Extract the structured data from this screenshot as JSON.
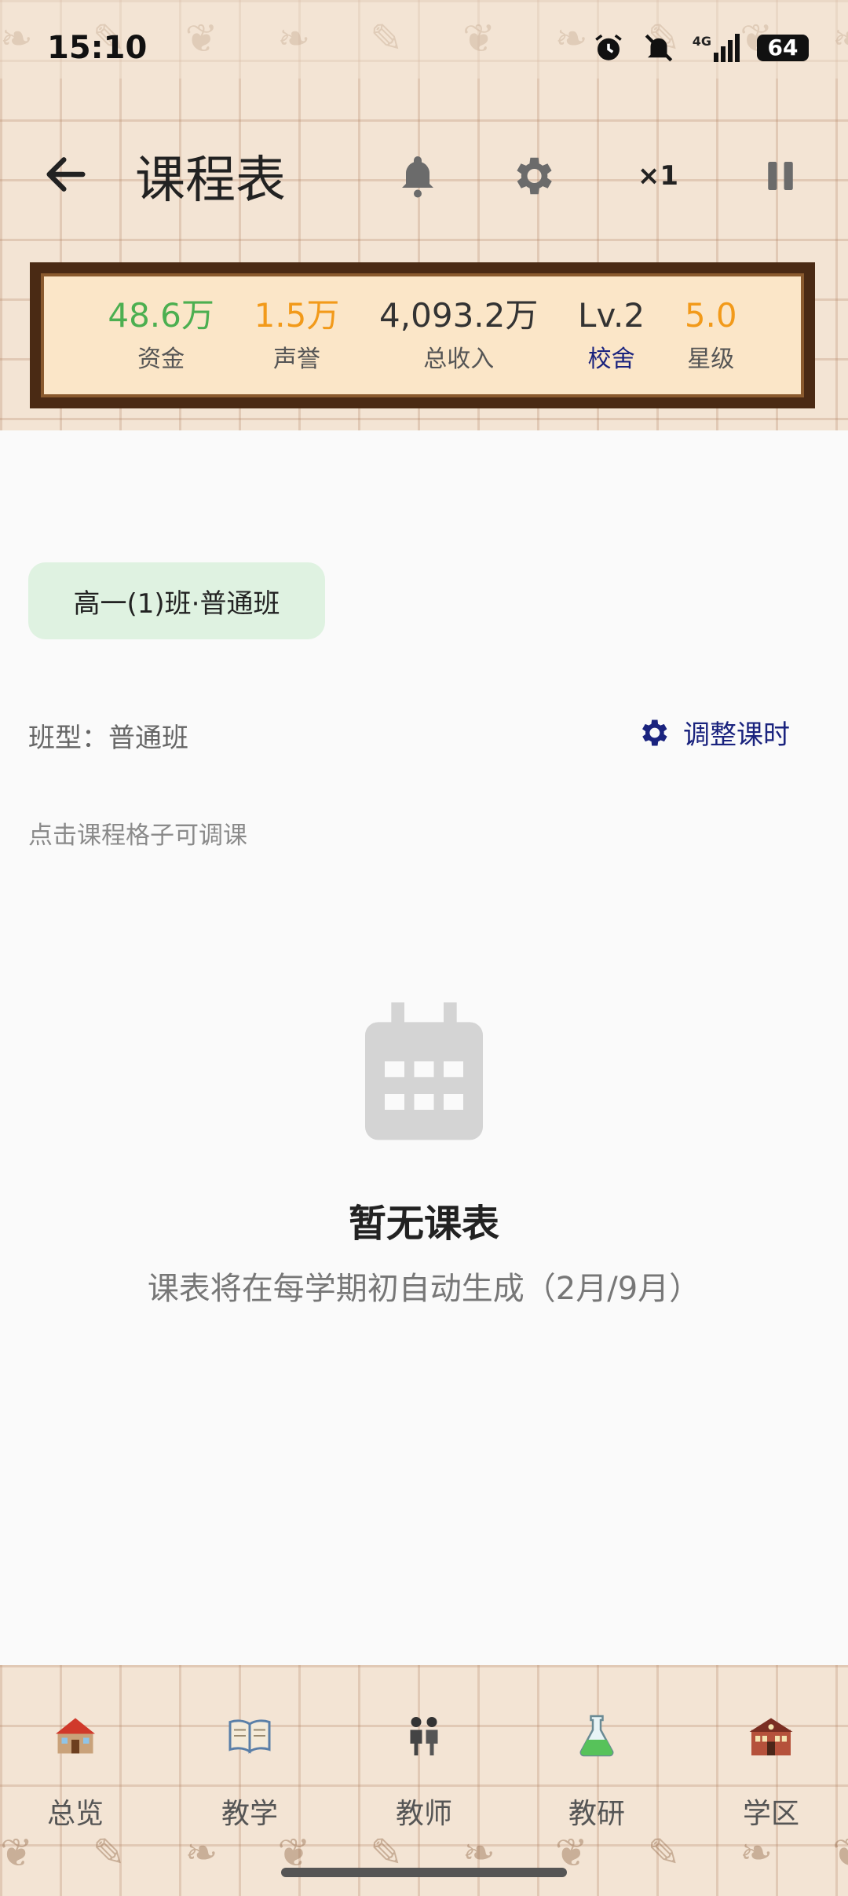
{
  "status_bar": {
    "time": "15:10",
    "battery": "64",
    "network": "4G"
  },
  "app_bar": {
    "title": "课程表",
    "speed": "×1"
  },
  "stats": [
    {
      "value": "48.6万",
      "label": "资金",
      "value_color": "#4caf50",
      "label_color": "#555555"
    },
    {
      "value": "1.5万",
      "label": "声誉",
      "value_color": "#f29a1a",
      "label_color": "#555555"
    },
    {
      "value": "4,093.2万",
      "label": "总收入",
      "value_color": "#333333",
      "label_color": "#555555"
    },
    {
      "value": "Lv.2",
      "label": "校舍",
      "value_color": "#333333",
      "label_color": "#1a237e"
    },
    {
      "value": "5.0",
      "label": "星级",
      "value_color": "#f29a1a",
      "label_color": "#555555"
    }
  ],
  "main": {
    "class_chip": "高一(1)班·普通班",
    "class_type": "班型：普通班",
    "adjust_label": "调整课时",
    "hint": "点击课程格子可调课",
    "empty_title": "暂无课表",
    "empty_desc": "课表将在每学期初自动生成（2月/9月）"
  },
  "bottom_nav": [
    {
      "label": "总览",
      "icon": "school-house-icon"
    },
    {
      "label": "教学",
      "icon": "open-book-icon"
    },
    {
      "label": "教师",
      "icon": "teachers-icon"
    },
    {
      "label": "教研",
      "icon": "flask-icon"
    },
    {
      "label": "学区",
      "icon": "school-building-icon"
    }
  ],
  "colors": {
    "accent": "#1a237e",
    "chip_bg": "#dff2e1",
    "panel_bg": "#fbe6c8",
    "panel_border": "#4a2a14"
  }
}
